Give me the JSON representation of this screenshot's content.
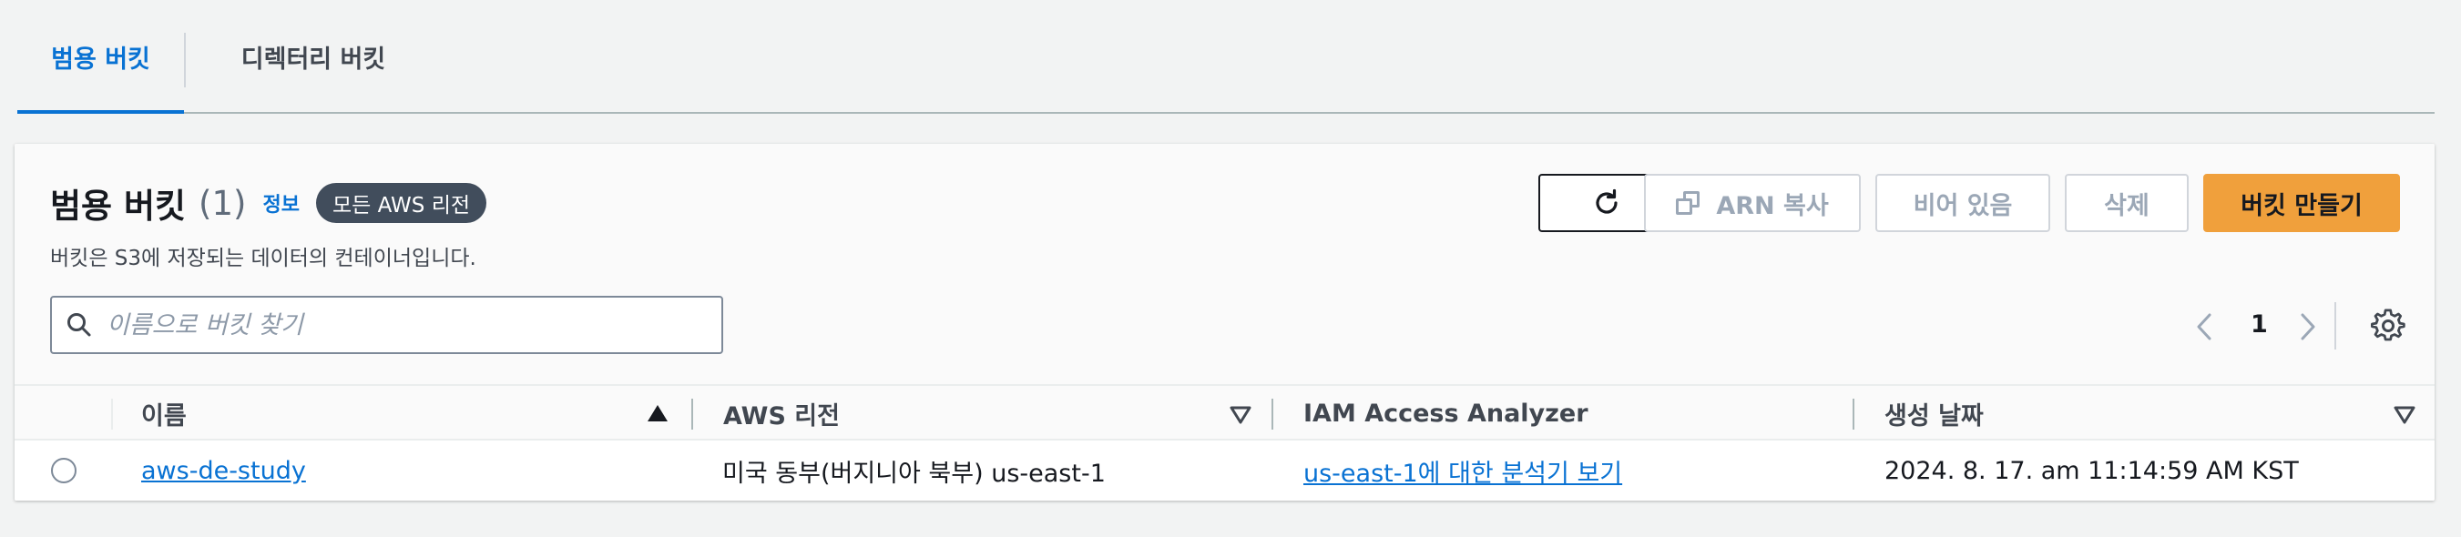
{
  "tabs": [
    {
      "label": "범용 버킷",
      "active": true
    },
    {
      "label": "디렉터리 버킷",
      "active": false
    }
  ],
  "panel": {
    "title": "범용 버킷",
    "count": "(1)",
    "info_link": "정보",
    "region_badge": "모든 AWS 리전",
    "description": "버킷은 S3에 저장되는 데이터의 컨테이너입니다."
  },
  "actions": {
    "refresh_icon": "refresh-icon",
    "copy_arn_label": "ARN 복사",
    "empty_label": "비어 있음",
    "delete_label": "삭제",
    "create_label": "버킷 만들기"
  },
  "search": {
    "placeholder": "이름으로 버킷 찾기",
    "value": ""
  },
  "pagination": {
    "current_page": "1"
  },
  "table": {
    "columns": [
      {
        "label": "이름",
        "sort": "ascending"
      },
      {
        "label": "AWS 리전",
        "sort": "none"
      },
      {
        "label": "IAM Access Analyzer",
        "sort": null
      },
      {
        "label": "생성 날짜",
        "sort": "none"
      }
    ],
    "rows": [
      {
        "selected": false,
        "name": "aws-de-study",
        "region": "미국 동부(버지니아 북부) us-east-1",
        "analyzer": "us-east-1에 대한 분석기 보기",
        "created": "2024. 8. 17. am 11:14:59 AM KST"
      }
    ]
  },
  "colors": {
    "accent": "#0972d3",
    "primary_button": "#f0a03c",
    "badge": "#414d5c"
  }
}
